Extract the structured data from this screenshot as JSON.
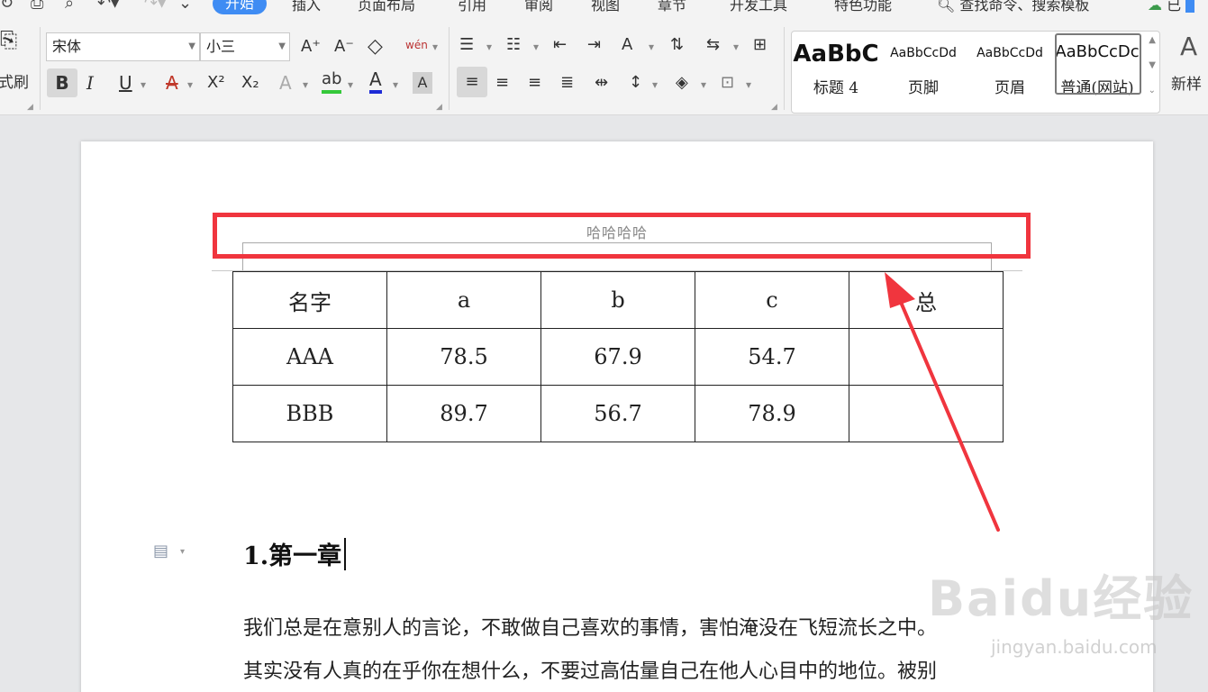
{
  "menu": {
    "tabs": [
      "开始",
      "插入",
      "页面布局",
      "引用",
      "审阅",
      "视图",
      "章节",
      "开发工具",
      "特色功能"
    ],
    "search": "查找命令、搜索模板",
    "sync": "已"
  },
  "ribbon": {
    "format_painter": "式刷",
    "font_name": "宋体",
    "font_size": "小三",
    "bold": "B",
    "italic": "I",
    "underline": "U",
    "strike": "A",
    "superscript": "X²",
    "subscript": "X₂",
    "text_effect": "A",
    "highlight": "ab",
    "font_color": "A",
    "char_shade": "A",
    "grow": "A⁺",
    "shrink": "A⁻",
    "clear": "◇",
    "phonetic": "wén",
    "new_style": "新样"
  },
  "styles": [
    {
      "preview": "AaBbC",
      "name": "标题 4"
    },
    {
      "preview": "AaBbCcDd",
      "name": "页脚"
    },
    {
      "preview": "AaBbCcDd",
      "name": "页眉"
    },
    {
      "preview": "AaBbCcDc",
      "name": "普通(网站)"
    }
  ],
  "document": {
    "header_text": "哈哈哈哈",
    "table": {
      "header": [
        "名字",
        "a",
        "b",
        "c",
        "总"
      ],
      "rows": [
        [
          "AAA",
          "78.5",
          "67.9",
          "54.7",
          ""
        ],
        [
          "BBB",
          "89.7",
          "56.7",
          "78.9",
          ""
        ]
      ]
    },
    "heading": "1.第一章",
    "paragraph_lines": [
      "我们总是在意别人的言论，不敢做自己喜欢的事情，害怕淹没在飞短流长之中。",
      "其实没有人真的在乎你在想什么，不要过高估量自己在他人心目中的地位。被别"
    ]
  },
  "watermark": {
    "logo": "Baidu经验",
    "url": "jingyan.baidu.com"
  },
  "colors": {
    "accent_tab": "#3f8cf3",
    "highlight_red": "#f0353e"
  }
}
